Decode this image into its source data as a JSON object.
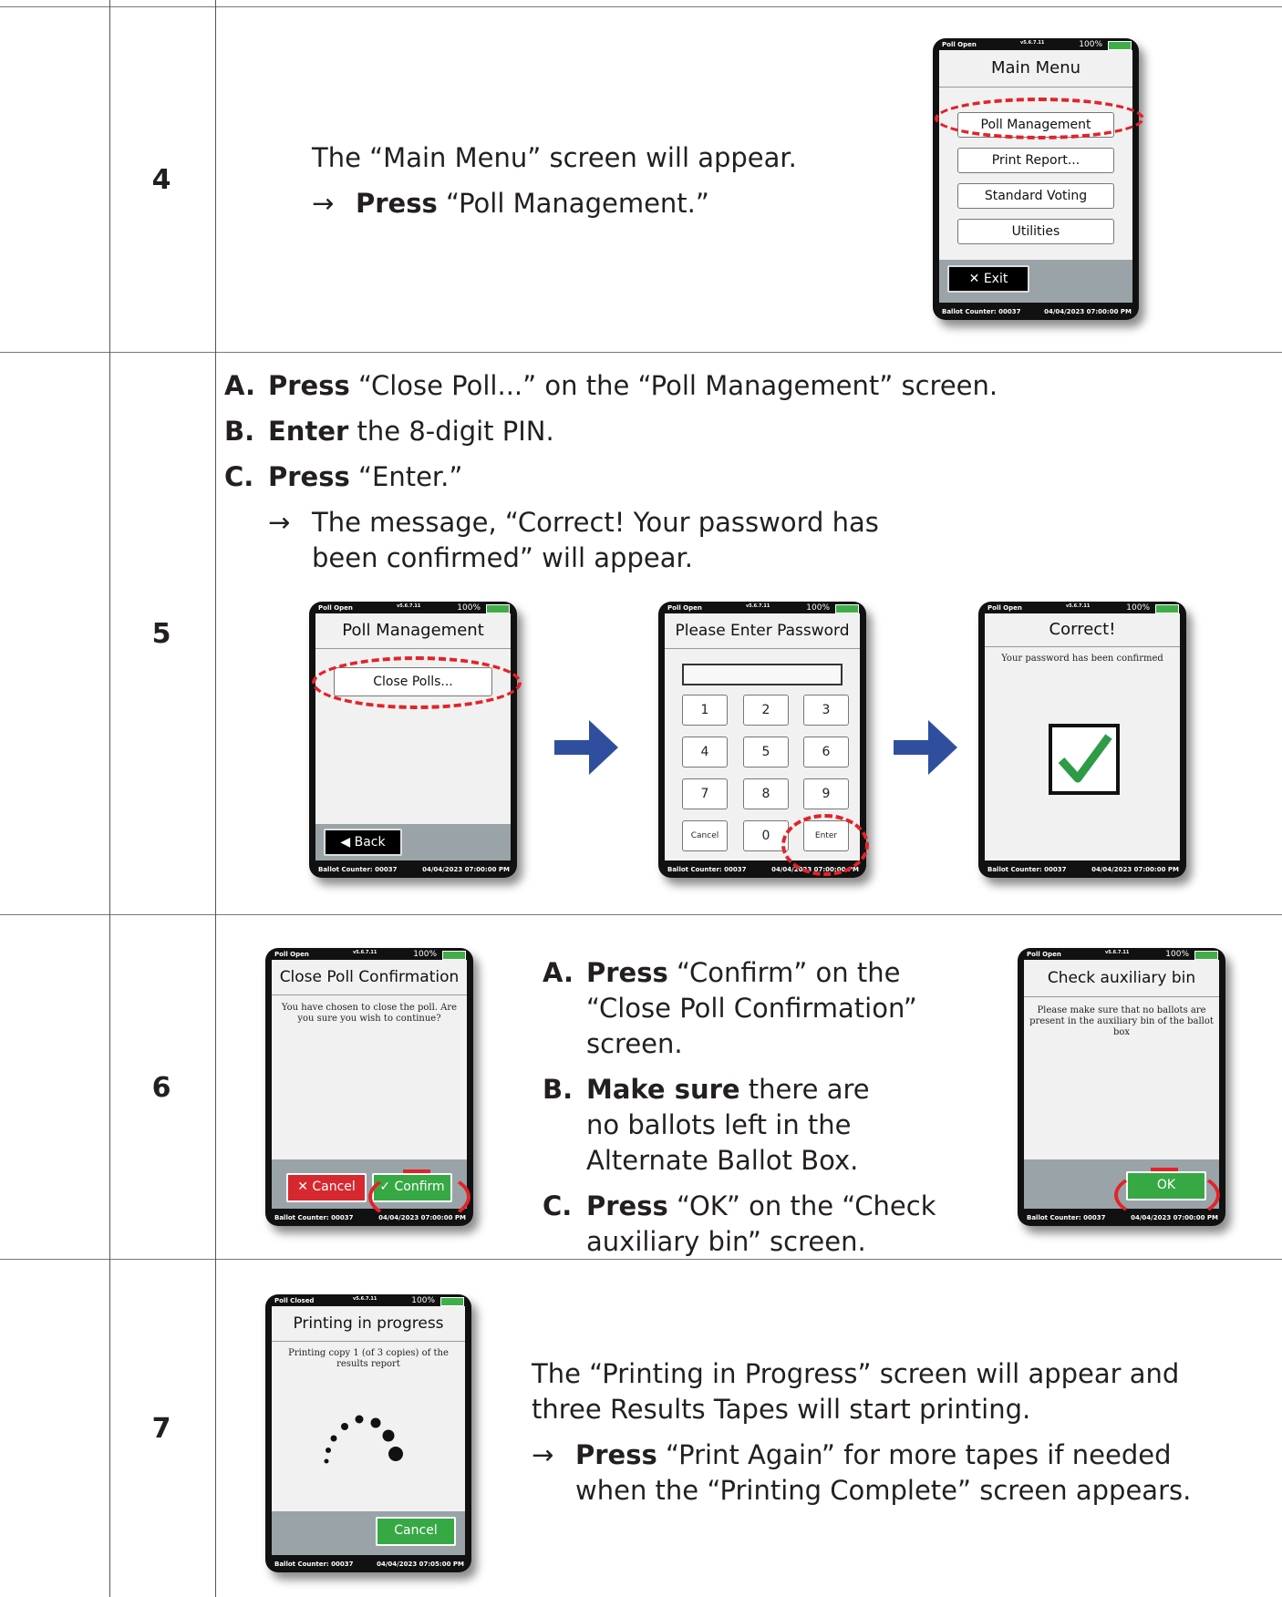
{
  "steps": [
    {
      "number": "4",
      "text": {
        "line1": "The “Main Menu” screen will appear.",
        "arrow": "→",
        "press": "Press",
        "rest": " “Poll Management.”"
      },
      "screen": {
        "status": "Poll Open",
        "version": "v5.6.7.11",
        "battery": "100%",
        "title": "Main Menu",
        "buttons": [
          "Poll Management",
          "Print Report...",
          "Standard Voting",
          "Utilities"
        ],
        "exit": "Exit",
        "exit_icon": "close-x-icon",
        "counter": "Ballot Counter: 00037",
        "datetime": "04/04/2023 07:00:00 PM"
      }
    },
    {
      "number": "5",
      "items": [
        {
          "letter": "A.",
          "verb": "Press",
          "rest": " “Close Poll...” on the “Poll Management” screen."
        },
        {
          "letter": "B.",
          "verb": "Enter",
          "rest": " the 8-digit PIN."
        },
        {
          "letter": "C.",
          "verb": "Press",
          "rest": " “Enter.”"
        }
      ],
      "arrow": "→",
      "note": "The message, “Correct!  Your password has been confirmed” will appear.",
      "screen_a": {
        "status": "Poll Open",
        "version": "v5.6.7.11",
        "battery": "100%",
        "title": "Poll Management",
        "button": "Close Polls...",
        "back": "Back",
        "counter": "Ballot Counter: 00037",
        "datetime": "04/04/2023 07:00:00 PM"
      },
      "screen_b": {
        "status": "Poll Open",
        "version": "v5.6.7.11",
        "battery": "100%",
        "title": "Please Enter Password",
        "keys": [
          "1",
          "2",
          "3",
          "4",
          "5",
          "6",
          "7",
          "8",
          "9"
        ],
        "cancel": "Cancel",
        "zero": "0",
        "enter": "Enter",
        "counter": "Ballot Counter: 00037",
        "datetime": "04/04/2023 07:00:00 PM"
      },
      "screen_c": {
        "status": "Poll Open",
        "version": "v5.6.7.11",
        "battery": "100%",
        "title": "Correct!",
        "message": "Your password has been confirmed",
        "counter": "Ballot Counter: 00037",
        "datetime": "04/04/2023 07:00:00 PM"
      }
    },
    {
      "number": "6",
      "items": [
        {
          "letter": "A.",
          "verb": "Press",
          "rest": " “Confirm” on the “Close Poll Confirmation” screen."
        },
        {
          "letter": "B.",
          "verb": "Make sure",
          "rest": " there are no ballots left in the Alternate Ballot Box."
        },
        {
          "letter": "C.",
          "verb": "Press",
          "rest": " “OK” on the “Check auxiliary bin” screen."
        }
      ],
      "screen_a": {
        "status": "Poll Open",
        "version": "v5.6.7.11",
        "battery": "100%",
        "title": "Close Poll Confirmation",
        "message": "You have chosen to close the poll. Are you sure you wish to continue?",
        "cancel": "Cancel",
        "confirm": "Confirm",
        "counter": "Ballot Counter: 00037",
        "datetime": "04/04/2023 07:00:00 PM"
      },
      "screen_b": {
        "status": "Poll Open",
        "version": "v5.6.7.11",
        "battery": "100%",
        "title": "Check auxiliary bin",
        "message": "Please make sure that no ballots are present in the auxiliary bin of the ballot box",
        "ok": "OK",
        "counter": "Ballot Counter: 00037",
        "datetime": "04/04/2023 07:00:00 PM"
      }
    },
    {
      "number": "7",
      "text": {
        "line1": "The “Printing in Progress” screen will appear and three Results Tapes will start printing.",
        "arrow": "→",
        "press": "Press",
        "rest": " “Print Again” for more tapes if needed when the “Printing Complete” screen appears."
      },
      "screen": {
        "status": "Poll Closed",
        "version": "v5.6.7.11",
        "battery": "100%",
        "title": "Printing in progress",
        "message": "Printing copy 1 (of 3 copies) of the results report",
        "cancel": "Cancel",
        "counter": "Ballot Counter: 00037",
        "datetime": "04/04/2023 07:05:00 PM"
      }
    }
  ],
  "colors": {
    "highlight": "#e2232a",
    "arrow": "#2f4f9e",
    "green": "#36a944",
    "red": "#d6282e"
  }
}
